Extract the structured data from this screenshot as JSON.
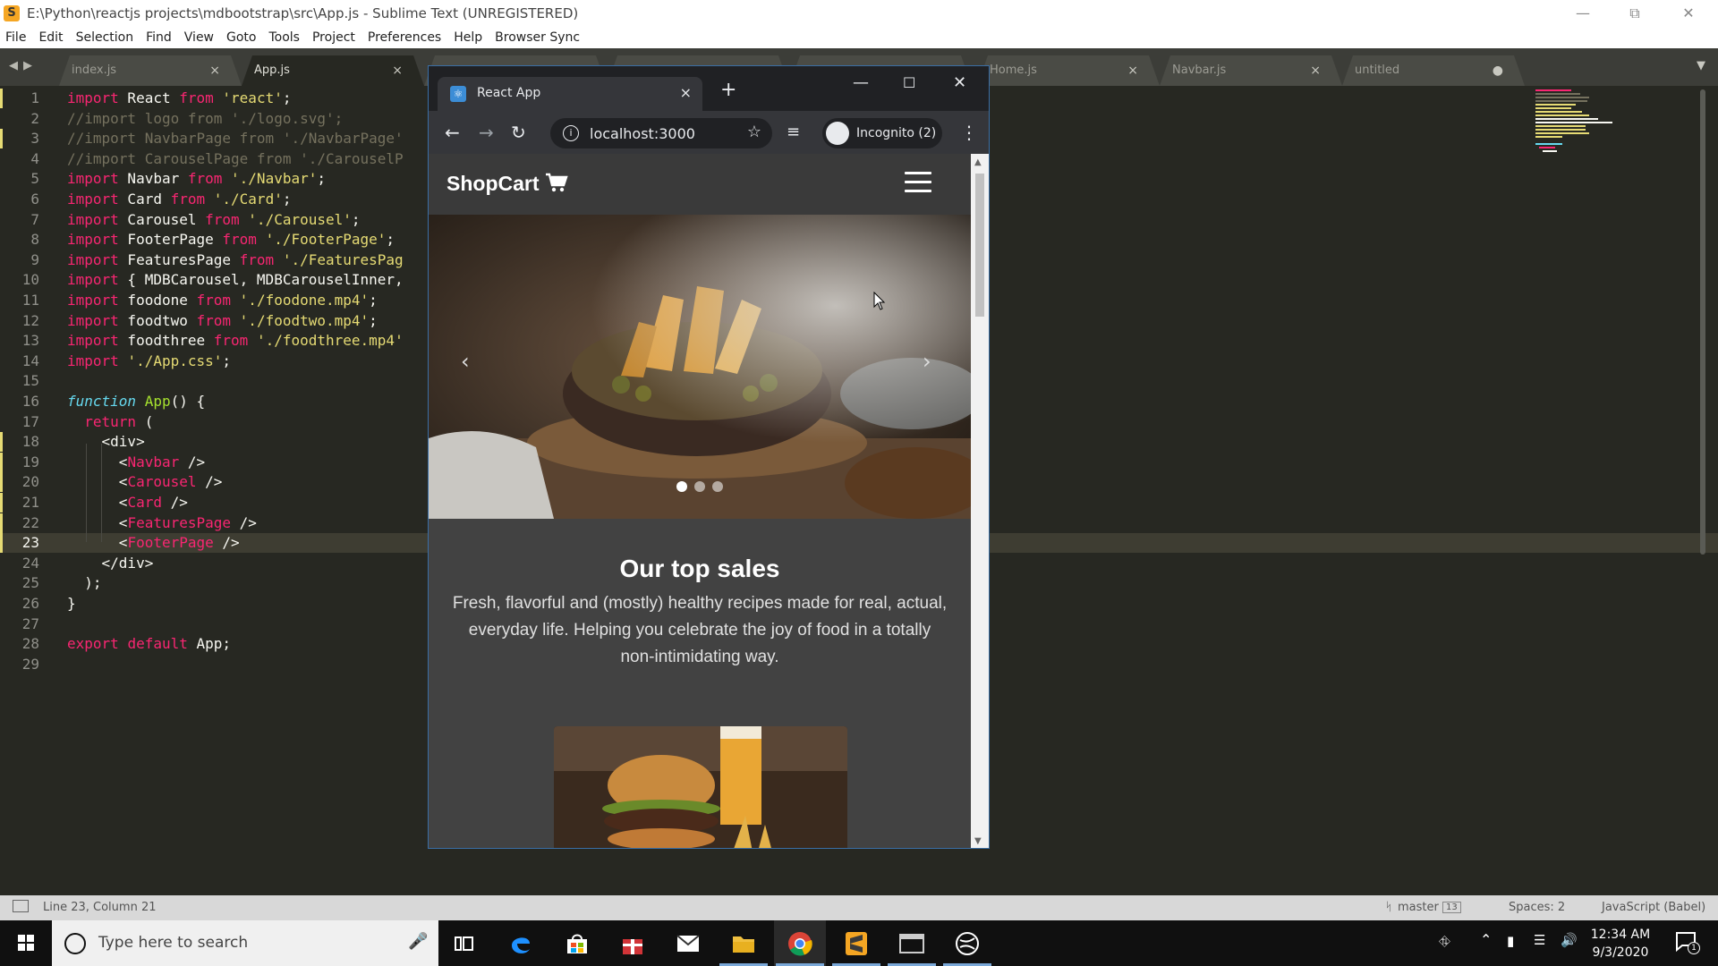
{
  "editor_window": {
    "title": "E:\\Python\\reactjs projects\\mdbootstrap\\src\\App.js - Sublime Text (UNREGISTERED)",
    "menu": [
      "File",
      "Edit",
      "Selection",
      "Find",
      "View",
      "Goto",
      "Tools",
      "Project",
      "Preferences",
      "Help",
      "Browser Sync"
    ],
    "tabs": [
      {
        "label": "index.js",
        "close": "×",
        "active": false
      },
      {
        "label": "App.js",
        "close": "×",
        "active": true
      },
      {
        "label": "",
        "close": "",
        "active": false
      },
      {
        "label": "",
        "close": "",
        "active": false
      },
      {
        "label": "",
        "close": "",
        "active": false
      },
      {
        "label": "Home.js",
        "close": "×",
        "active": false
      },
      {
        "label": "Navbar.js",
        "close": "×",
        "active": false
      },
      {
        "label": "untitled",
        "close": "●",
        "active": false
      }
    ],
    "current_line": 23,
    "line_numbers": [
      "1",
      "2",
      "3",
      "4",
      "5",
      "6",
      "7",
      "8",
      "9",
      "10",
      "11",
      "12",
      "13",
      "14",
      "15",
      "16",
      "17",
      "18",
      "19",
      "20",
      "21",
      "22",
      "23",
      "24",
      "25",
      "26",
      "27",
      "28",
      "29"
    ],
    "code_lines": [
      [
        {
          "t": "import",
          "c": "kw"
        },
        {
          "t": " React "
        },
        {
          "t": "from",
          "c": "kw"
        },
        {
          "t": " "
        },
        {
          "t": "'react'",
          "c": "str"
        },
        {
          "t": ";"
        }
      ],
      [
        {
          "t": "//import logo from './logo.svg';",
          "c": "cm"
        }
      ],
      [
        {
          "t": "//import NavbarPage from './NavbarPage'",
          "c": "cm"
        }
      ],
      [
        {
          "t": "//import CarouselPage from './CarouselP",
          "c": "cm"
        }
      ],
      [
        {
          "t": "import",
          "c": "kw"
        },
        {
          "t": " Navbar "
        },
        {
          "t": "from",
          "c": "kw"
        },
        {
          "t": " "
        },
        {
          "t": "'./Navbar'",
          "c": "str"
        },
        {
          "t": ";"
        }
      ],
      [
        {
          "t": "import",
          "c": "kw"
        },
        {
          "t": " Card "
        },
        {
          "t": "from",
          "c": "kw"
        },
        {
          "t": " "
        },
        {
          "t": "'./Card'",
          "c": "str"
        },
        {
          "t": ";"
        }
      ],
      [
        {
          "t": "import",
          "c": "kw"
        },
        {
          "t": " Carousel "
        },
        {
          "t": "from",
          "c": "kw"
        },
        {
          "t": " "
        },
        {
          "t": "'./Carousel'",
          "c": "str"
        },
        {
          "t": ";"
        }
      ],
      [
        {
          "t": "import",
          "c": "kw"
        },
        {
          "t": " FooterPage "
        },
        {
          "t": "from",
          "c": "kw"
        },
        {
          "t": " "
        },
        {
          "t": "'./FooterPage'",
          "c": "str"
        },
        {
          "t": ";"
        }
      ],
      [
        {
          "t": "import",
          "c": "kw"
        },
        {
          "t": " FeaturesPage "
        },
        {
          "t": "from",
          "c": "kw"
        },
        {
          "t": " "
        },
        {
          "t": "'./FeaturesPag",
          "c": "str"
        }
      ],
      [
        {
          "t": "import",
          "c": "kw"
        },
        {
          "t": " { MDBCarousel, MDBCarouselInner,"
        }
      ],
      [
        {
          "t": "import",
          "c": "kw"
        },
        {
          "t": " foodone "
        },
        {
          "t": "from",
          "c": "kw"
        },
        {
          "t": " "
        },
        {
          "t": "'./foodone.mp4'",
          "c": "str"
        },
        {
          "t": ";"
        }
      ],
      [
        {
          "t": "import",
          "c": "kw"
        },
        {
          "t": " foodtwo "
        },
        {
          "t": "from",
          "c": "kw"
        },
        {
          "t": " "
        },
        {
          "t": "'./foodtwo.mp4'",
          "c": "str"
        },
        {
          "t": ";"
        }
      ],
      [
        {
          "t": "import",
          "c": "kw"
        },
        {
          "t": " foodthree "
        },
        {
          "t": "from",
          "c": "kw"
        },
        {
          "t": " "
        },
        {
          "t": "'./foodthree.mp4'",
          "c": "str"
        }
      ],
      [
        {
          "t": "import",
          "c": "kw"
        },
        {
          "t": " "
        },
        {
          "t": "'./App.css'",
          "c": "str"
        },
        {
          "t": ";"
        }
      ],
      [],
      [
        {
          "t": "function",
          "c": "it"
        },
        {
          "t": " "
        },
        {
          "t": "App",
          "c": "fn"
        },
        {
          "t": "() {"
        }
      ],
      [
        {
          "t": "  "
        },
        {
          "t": "return",
          "c": "kw"
        },
        {
          "t": " ("
        }
      ],
      [
        {
          "t": "    <div>"
        }
      ],
      [
        {
          "t": "      <"
        },
        {
          "t": "Navbar",
          "c": "tag"
        },
        {
          "t": " />"
        }
      ],
      [
        {
          "t": "      <"
        },
        {
          "t": "Carousel",
          "c": "tag"
        },
        {
          "t": " />"
        }
      ],
      [
        {
          "t": "      <"
        },
        {
          "t": "Card",
          "c": "tag"
        },
        {
          "t": " />"
        }
      ],
      [
        {
          "t": "      <"
        },
        {
          "t": "FeaturesPage",
          "c": "tag"
        },
        {
          "t": " />"
        }
      ],
      [
        {
          "t": "      <"
        },
        {
          "t": "FooterPage",
          "c": "tag"
        },
        {
          "t": " />"
        }
      ],
      [
        {
          "t": "    </div>"
        }
      ],
      [
        {
          "t": "  );"
        }
      ],
      [
        {
          "t": "}"
        }
      ],
      [],
      [
        {
          "t": "export",
          "c": "kw"
        },
        {
          "t": " "
        },
        {
          "t": "default",
          "c": "kw"
        },
        {
          "t": " App;"
        }
      ],
      []
    ],
    "status": {
      "position": "Line 23, Column 21",
      "branch": "master",
      "branch_count": "13",
      "spaces": "Spaces: 2",
      "syntax": "JavaScript (Babel)"
    },
    "colors": {
      "background": "#272822",
      "keyword": "#f92672",
      "string": "#e6db74",
      "comment": "#75715e",
      "function": "#a6e22e"
    }
  },
  "browser": {
    "tab_title": "React App",
    "tab_close": "×",
    "new_tab": "+",
    "url": "localhost:3000",
    "profile": "Incognito (2)"
  },
  "page": {
    "brand": "ShopCart",
    "carousel": {
      "slide_count": 3,
      "active_slide": 1
    },
    "section_title": "Our top sales",
    "section_text": "Fresh, flavorful and (mostly) healthy recipes made for real, actual, everyday life. Helping you celebrate the joy of food in a totally non-intimidating way."
  },
  "taskbar": {
    "search_placeholder": "Type here to search",
    "time": "12:34 AM",
    "date": "9/3/2020",
    "notification_count": "1",
    "icons": [
      "task-view-icon",
      "edge-icon",
      "store-icon",
      "gift-icon",
      "mail-icon",
      "file-explorer-icon",
      "chrome-icon",
      "sublime-text-icon",
      "terminal-icon",
      "app-icon"
    ]
  }
}
